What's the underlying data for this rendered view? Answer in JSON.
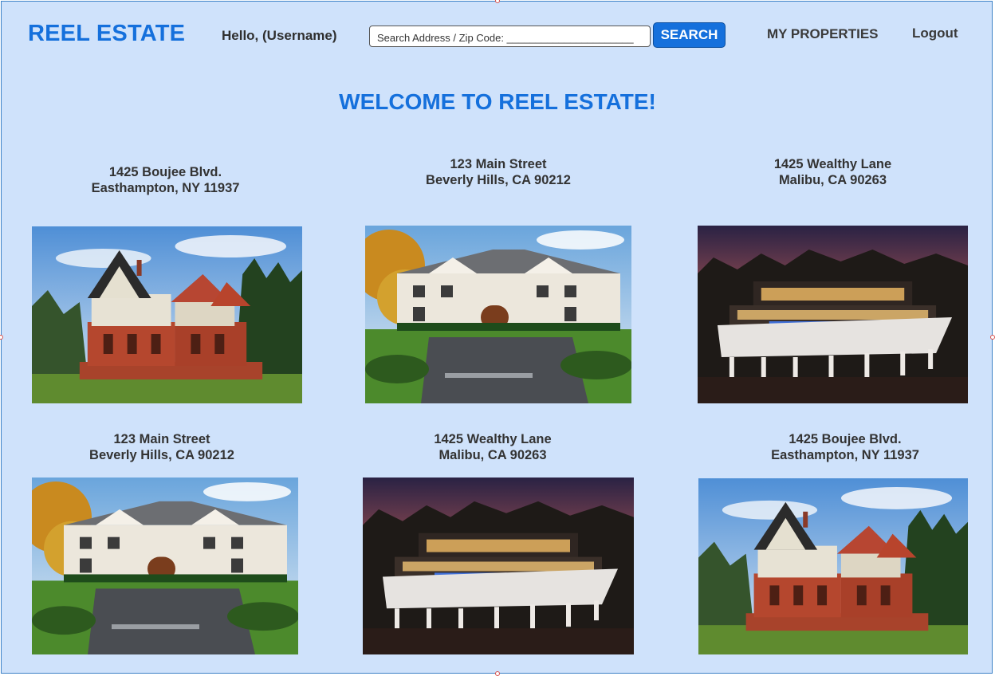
{
  "header": {
    "brand": "REEL ESTATE",
    "greeting": "Hello, (Username)",
    "search_placeholder": "Search Address / Zip Code: ______________________",
    "search_button": "SEARCH",
    "my_properties": "MY PROPERTIES",
    "logout": "Logout"
  },
  "main": {
    "welcome": "WELCOME TO REEL ESTATE!",
    "listings": [
      {
        "street": "1425 Boujee Blvd.",
        "city": "Easthampton, NY 11937",
        "image": "tudor-mansion"
      },
      {
        "street": "123 Main Street",
        "city": "Beverly Hills, CA 90212",
        "image": "white-estate"
      },
      {
        "street": "1425 Wealthy Lane",
        "city": "Malibu, CA 90263",
        "image": "modern-cliff-house"
      },
      {
        "street": "123 Main Street",
        "city": "Beverly Hills, CA 90212",
        "image": "white-estate"
      },
      {
        "street": "1425 Wealthy Lane",
        "city": "Malibu, CA 90263",
        "image": "modern-cliff-house"
      },
      {
        "street": "1425 Boujee Blvd.",
        "city": "Easthampton, NY 11937",
        "image": "tudor-mansion"
      }
    ]
  },
  "colors": {
    "background": "#cfe2fb",
    "accent": "#1570dc",
    "text": "#333333"
  }
}
